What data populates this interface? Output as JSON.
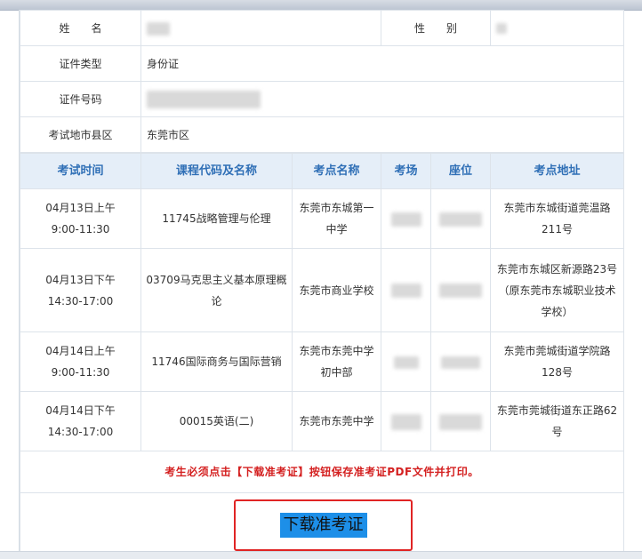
{
  "info": {
    "name_label": "姓　　名",
    "gender_label": "性　　别",
    "id_type_label": "证件类型",
    "id_type_value": "身份证",
    "id_number_label": "证件号码",
    "region_label": "考试地市县区",
    "region_value": "东莞市区"
  },
  "schedule": {
    "headers": [
      "考试时间",
      "课程代码及名称",
      "考点名称",
      "考场",
      "座位",
      "考点地址"
    ],
    "rows": [
      {
        "date": "04月13日上午",
        "time": "9:00-11:30",
        "course": "11745战略管理与伦理",
        "site_line1": "东莞市东城第一",
        "site_line2": "中学",
        "address_line1": "东莞市东城街道莞温路",
        "address_line2": "211号",
        "address_line3": ""
      },
      {
        "date": "04月13日下午",
        "time": "14:30-17:00",
        "course_line1": "03709马克思主义基本原理概",
        "course_line2": "论",
        "site": "东莞市商业学校",
        "address_line1": "东莞市东城区新源路23号",
        "address_line2": "（原东莞市东城职业技术",
        "address_line3": "学校）"
      },
      {
        "date": "04月14日上午",
        "time": "9:00-11:30",
        "course": "11746国际商务与国际营销",
        "site_line1": "东莞市东莞中学",
        "site_line2": "初中部",
        "address_line1": "东莞市莞城街道学院路",
        "address_line2": "128号"
      },
      {
        "date": "04月14日下午",
        "time": "14:30-17:00",
        "course": "00015英语(二)",
        "site": "东莞市东莞中学",
        "address_line1": "东莞市莞城街道东正路62",
        "address_line2": "号"
      }
    ]
  },
  "notice": "考生必须点击【下载准考证】按钮保存准考证PDF文件并打印。",
  "download_button": "下载准考证",
  "colors": {
    "header_bg": "#e5eef8",
    "header_text": "#2f6fb6",
    "notice": "#d42020",
    "button_bg": "#1d8fe8",
    "highlight_border": "#e02424"
  }
}
